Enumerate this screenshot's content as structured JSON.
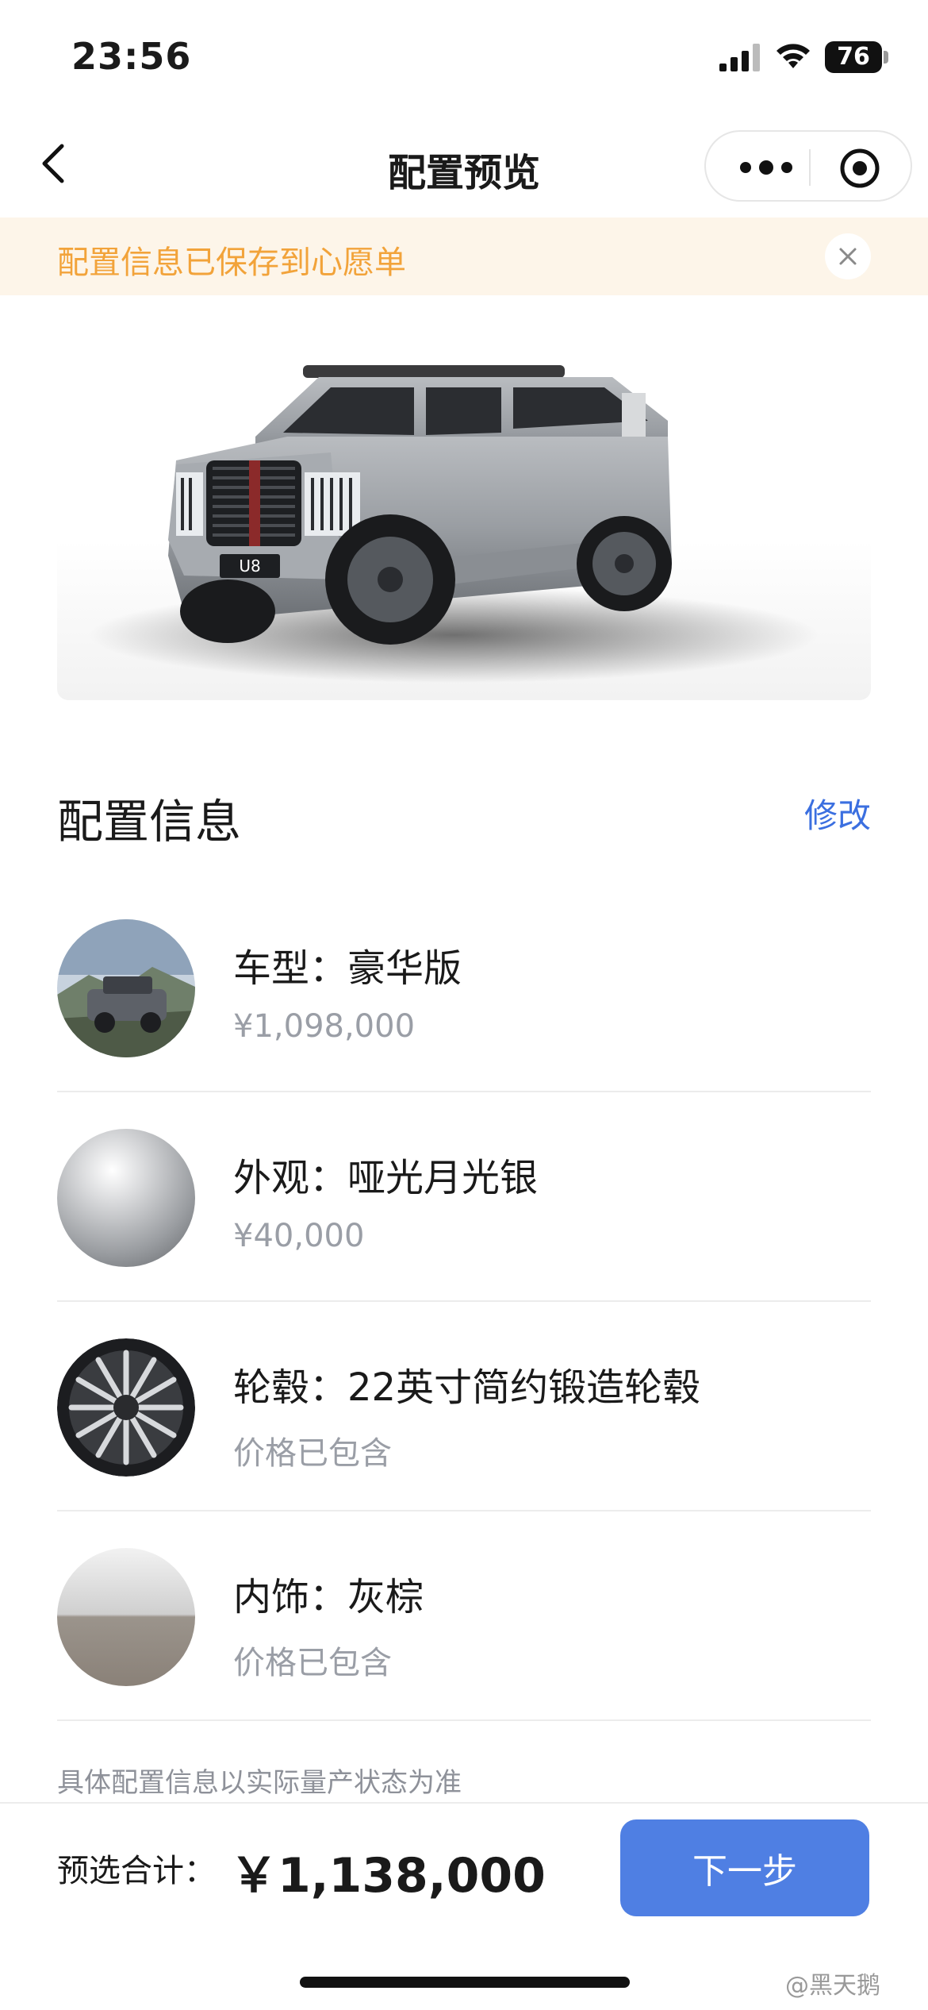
{
  "status_bar": {
    "time": "23:56",
    "battery": "76"
  },
  "nav": {
    "title": "配置预览"
  },
  "notice": {
    "text": "配置信息已保存到心愿单"
  },
  "hero": {
    "plate": "U8"
  },
  "section": {
    "title": "配置信息",
    "edit_label": "修改"
  },
  "config_items": [
    {
      "title": "车型：豪华版",
      "sub": "¥1,098,000"
    },
    {
      "title": "外观：哑光月光银",
      "sub": "¥40,000"
    },
    {
      "title": "轮毂：22英寸简约锻造轮毂",
      "sub": "价格已包含"
    },
    {
      "title": "内饰：灰棕",
      "sub": "价格已包含"
    }
  ],
  "disclaimer": "具体配置信息以实际量产状态为准",
  "footer": {
    "total_label": "预选合计：",
    "total_value": "￥1,138,000",
    "next_label": "下一步"
  },
  "watermark": "@黑天鹅",
  "colors": {
    "accent": "#4f7fe3",
    "link": "#3b6fe0",
    "notice_text": "#f2a33a",
    "notice_bg": "#fdf5e9"
  }
}
